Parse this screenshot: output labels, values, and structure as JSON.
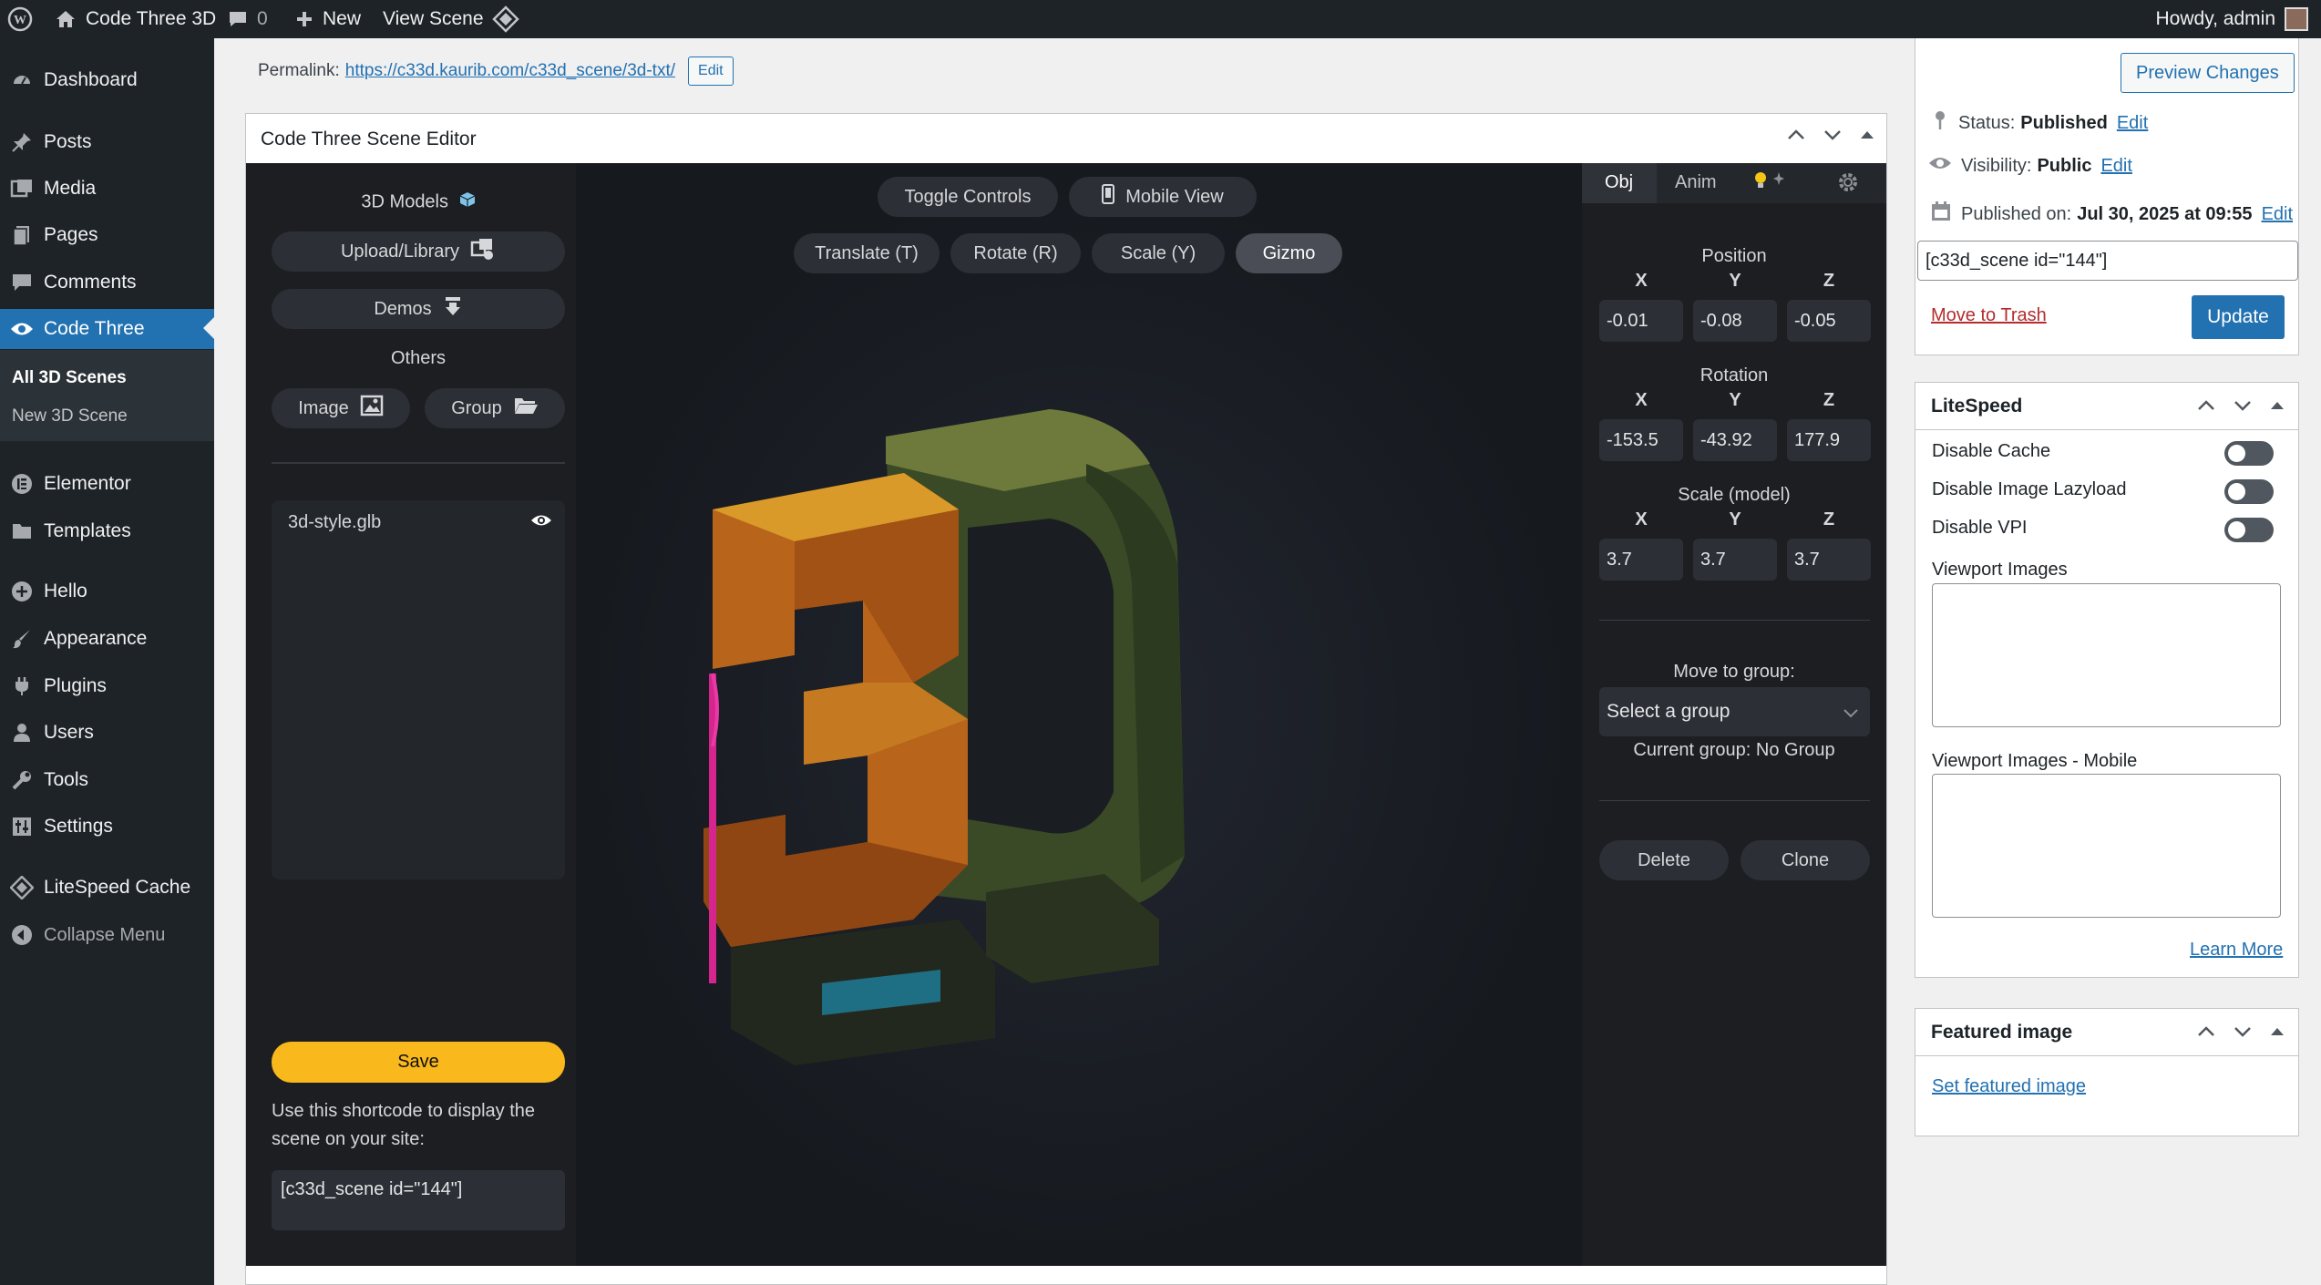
{
  "admin_bar": {
    "site_name": "Code Three 3D",
    "comments_count": "0",
    "new_label": "New",
    "view_label": "View Scene",
    "howdy": "Howdy, admin"
  },
  "sidebar": {
    "items": [
      {
        "label": "Dashboard",
        "icon": "dashboard-icon"
      },
      {
        "label": "Posts",
        "icon": "pin-icon"
      },
      {
        "label": "Media",
        "icon": "media-icon"
      },
      {
        "label": "Pages",
        "icon": "pages-icon"
      },
      {
        "label": "Comments",
        "icon": "comment-icon"
      },
      {
        "label": "Code Three",
        "icon": "eye-icon"
      },
      {
        "label": "Elementor",
        "icon": "elementor-icon"
      },
      {
        "label": "Templates",
        "icon": "folder-icon"
      },
      {
        "label": "Hello",
        "icon": "plus-circle-icon"
      },
      {
        "label": "Appearance",
        "icon": "brush-icon"
      },
      {
        "label": "Plugins",
        "icon": "plug-icon"
      },
      {
        "label": "Users",
        "icon": "user-icon"
      },
      {
        "label": "Tools",
        "icon": "wrench-icon"
      },
      {
        "label": "Settings",
        "icon": "settings-icon"
      },
      {
        "label": "LiteSpeed Cache",
        "icon": "diamond-icon"
      },
      {
        "label": "Collapse Menu",
        "icon": "collapse-icon"
      }
    ],
    "submenu": [
      "All 3D Scenes",
      "New 3D Scene"
    ]
  },
  "permalink": {
    "label": "Permalink:",
    "url": "https://c33d.kaurib.com/c33d_scene/3d-txt/",
    "edit_label": "Edit"
  },
  "editor": {
    "title": "Code Three Scene Editor",
    "left": {
      "models_label": "3D Models",
      "upload_label": "Upload/Library",
      "demos_label": "Demos",
      "others_label": "Others",
      "image_label": "Image",
      "group_label": "Group",
      "objects": [
        {
          "name": "3d-style.glb"
        }
      ],
      "save_label": "Save",
      "help_text": "Use this shortcode to display the scene on your site:",
      "shortcode": "[c33d_scene id=\"144\"]"
    },
    "viewport": {
      "toggle_controls": "Toggle Controls",
      "mobile_view": "Mobile View",
      "modes": [
        "Translate (T)",
        "Rotate (R)",
        "Scale (Y)",
        "Gizmo"
      ],
      "active_mode": "Gizmo"
    },
    "right": {
      "tabs": [
        "Obj",
        "Anim"
      ],
      "position_label": "Position",
      "rotation_label": "Rotation",
      "scale_label": "Scale (model)",
      "axes": [
        "X",
        "Y",
        "Z"
      ],
      "position": [
        "-0.01",
        "-0.08",
        "-0.05"
      ],
      "rotation": [
        "-153.5",
        "-43.92",
        "177.9"
      ],
      "scale": [
        "3.7",
        "3.7",
        "3.7"
      ],
      "move_to_group_label": "Move to group:",
      "group_select": "Select a group",
      "current_group": "Current group: No Group",
      "delete_label": "Delete",
      "clone_label": "Clone"
    }
  },
  "publish": {
    "preview_label": "Preview Changes",
    "status_label": "Status:",
    "status_value": "Published",
    "visibility_label": "Visibility:",
    "visibility_value": "Public",
    "published_label": "Published on:",
    "published_value": "Jul 30, 2025 at 09:55",
    "edit_label": "Edit",
    "shortcode_value": "[c33d_scene id=\"144\"]",
    "trash_label": "Move to Trash",
    "update_label": "Update"
  },
  "litespeed": {
    "title": "LiteSpeed",
    "toggles": [
      "Disable Cache",
      "Disable Image Lazyload",
      "Disable VPI"
    ],
    "viewport_images_label": "Viewport Images",
    "viewport_images_mobile_label": "Viewport Images - Mobile",
    "learn_more": "Learn More"
  },
  "featured": {
    "title": "Featured image",
    "set_label": "Set featured image"
  },
  "colors": {
    "wp_blue": "#2271b1",
    "save_yellow": "#f9b81b",
    "admin_dark": "#1d2327"
  }
}
